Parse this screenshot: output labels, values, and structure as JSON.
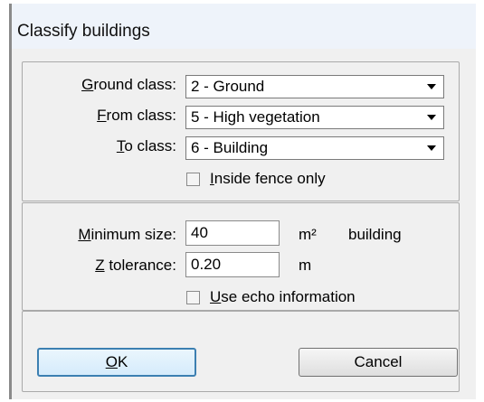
{
  "window": {
    "title": "Classify buildings"
  },
  "ground_class": {
    "label_accel": "G",
    "label_rest": "round class:",
    "value": "2 - Ground"
  },
  "from_class": {
    "label_accel": "F",
    "label_rest": "rom class:",
    "value": "5 - High vegetation"
  },
  "to_class": {
    "label_accel": "T",
    "label_rest": "o class:",
    "value": "6 - Building"
  },
  "inside_fence": {
    "label_accel": "I",
    "label_rest": "nside fence only",
    "checked": false
  },
  "minimum_size": {
    "label_accel": "M",
    "label_rest": "inimum size:",
    "value": "40",
    "unit": "m²",
    "suffix": "building"
  },
  "z_tolerance": {
    "label_accel": "Z",
    "label_rest": " tolerance:",
    "value": "0.20",
    "unit": "m"
  },
  "use_echo": {
    "label_accel": "U",
    "label_rest": "se echo information",
    "checked": false
  },
  "buttons": {
    "ok_accel": "O",
    "ok_rest": "K",
    "cancel": "Cancel"
  }
}
